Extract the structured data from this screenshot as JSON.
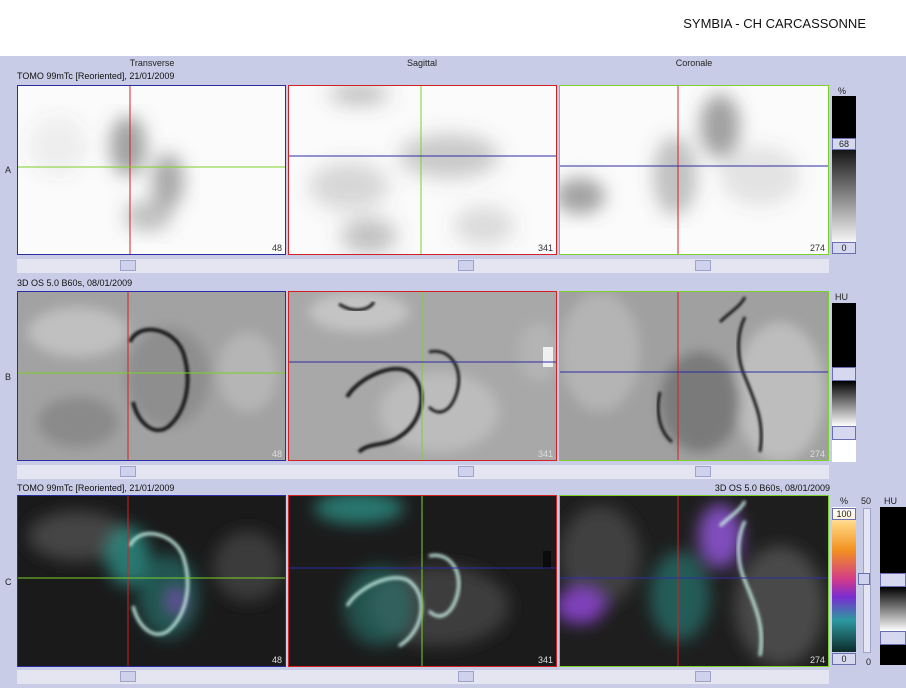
{
  "header": {
    "title": "SYMBIA - CH CARCASSONNE"
  },
  "columns": [
    "Transverse",
    "Sagittal",
    "Coronale"
  ],
  "rows": [
    {
      "id": "A",
      "info": "TOMO 99mTc [Reoriented], 21/01/2009",
      "numbers": [
        "48",
        "341",
        "274"
      ]
    },
    {
      "id": "B",
      "info": "3D  OS  5.0  B60s, 08/01/2009",
      "numbers": [
        "48",
        "341",
        "274"
      ]
    },
    {
      "id": "C",
      "info_left": "TOMO 99mTc [Reoriented], 21/01/2009",
      "info_right": "3D  OS  5.0  B60s, 08/01/2009",
      "numbers": [
        "48",
        "341",
        "274"
      ]
    }
  ],
  "scales": {
    "a": {
      "unit": "%",
      "value_top": "68",
      "value_bottom": "0"
    },
    "b": {
      "unit": "HU"
    },
    "c": {
      "unit": "%",
      "value_top": "100",
      "value_bottom": "0",
      "unit2": "HU",
      "slider_value": "50",
      "value_bottom2": "0"
    }
  },
  "colors": {
    "transverse_border": "#2b2ea3",
    "sagittal_border": "#d52020",
    "coronale_border": "#7ccf2c",
    "crosshair_red": "#d52020",
    "crosshair_green": "#7ccf2c",
    "crosshair_blue": "#2b2ea3"
  }
}
